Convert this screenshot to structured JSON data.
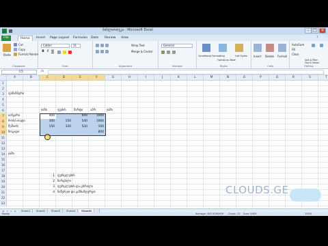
{
  "window": {
    "title": "ბიბლიოთეკა - Microsoft Excel"
  },
  "ribbon_tabs": [
    "File",
    "Home",
    "Insert",
    "Page Layout",
    "Formulas",
    "Data",
    "Review",
    "View"
  ],
  "ribbon": {
    "clipboard": {
      "paste": "Paste",
      "cut": "Cut",
      "copy": "Copy",
      "format_painter": "Format Painter",
      "label": "Clipboard"
    },
    "font": {
      "name": "Calibri",
      "size": "11",
      "bold": "B",
      "italic": "I",
      "underline": "U",
      "label": "Font"
    },
    "alignment": {
      "wrap": "Wrap Text",
      "merge": "Merge & Center",
      "label": "Alignment"
    },
    "number": {
      "format": "General",
      "label": "Number"
    },
    "styles": {
      "conditional": "Conditional Formatting",
      "format_table": "Format as Table",
      "cell_styles": "Cell Styles",
      "label": "Styles"
    },
    "cells": {
      "insert": "Insert",
      "delete": "Delete",
      "format": "Format",
      "label": "Cells"
    },
    "editing": {
      "autosum": "AutoSum",
      "fill": "Fill",
      "clear": "Clear",
      "sort": "Sort & Filter",
      "find": "Find & Select",
      "label": "Editing"
    }
  },
  "formula_bar": {
    "name_box": "C5",
    "fx": "fx",
    "value": ""
  },
  "columns": [
    "A",
    "B",
    "C",
    "D",
    "E",
    "F",
    "G",
    "H",
    "I",
    "J",
    "K",
    "L",
    "M",
    "N",
    "O",
    "P",
    "Q",
    "R",
    "S",
    "T"
  ],
  "rows": [
    "1",
    "2",
    "3",
    "4",
    "5",
    "6",
    "7",
    "8",
    "9",
    "10",
    "11",
    "12",
    "13",
    "14",
    "15",
    "16",
    "17",
    "18",
    "19",
    "20",
    "21",
    "22",
    "23"
  ],
  "cells": {
    "a2": "ფინანსური",
    "header": [
      "იანი",
      "ფების",
      "მარტი",
      "აპრ.",
      "ჯამი"
    ],
    "r6": {
      "label": "იანვარი",
      "v1": "400",
      "v2": "",
      "v3": "600",
      "v4": "1000"
    },
    "r7": {
      "label": "როსპ-თადი",
      "v1": "300",
      "v2": "150",
      "v3": "540",
      "v4": "1000"
    },
    "r8": {
      "label": "მუშაოს",
      "v1": "150",
      "v2": "330",
      "v3": "530",
      "v4": "100"
    },
    "r9": {
      "label": "ზოგადი",
      "v1": "",
      "v2": "",
      "v3": "",
      "v4": "800"
    },
    "a12": "ჯამი",
    "list": [
      {
        "num": "1",
        "text": "ფურცლების"
      },
      {
        "num": "2",
        "text": "ნარცხლი"
      },
      {
        "num": "3",
        "text": "ფურცლების და ცხრილი"
      },
      {
        "num": "4",
        "text": "ჩაწერეთ და განსაზღვრეთ"
      }
    ]
  },
  "sheet_tabs": [
    "Sheet1",
    "Sheet2",
    "Sheet3",
    "Sheet4",
    "Sheet5"
  ],
  "active_sheet": "Sheet5",
  "status": {
    "ready": "Ready",
    "average": "Average: 445.9090909",
    "count": "Count: 12",
    "sum": "Sum: 4905",
    "zoom": "100%"
  },
  "watermark": "CLOUDS.GE",
  "colors": {
    "selection": "#bcd3ee",
    "file_tab": "#2a8a3e",
    "ribbon": "#f2f6fb"
  }
}
